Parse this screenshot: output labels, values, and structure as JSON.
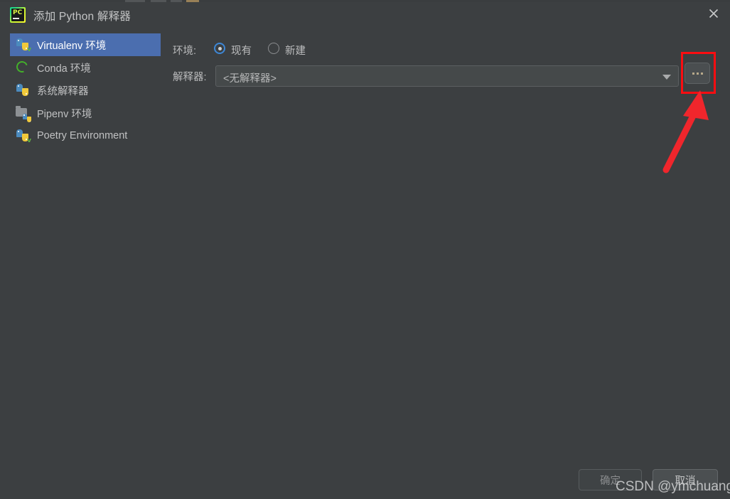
{
  "window": {
    "title": "添加 Python 解释器",
    "app_icon": "pycharm-icon",
    "icon_text": "PC",
    "close_icon": "close-icon"
  },
  "sidebar": {
    "items": [
      {
        "label": "Virtualenv 环境",
        "icon": "python-virtualenv-icon",
        "selected": true
      },
      {
        "label": "Conda 环境",
        "icon": "conda-icon",
        "selected": false
      },
      {
        "label": "系统解释器",
        "icon": "python-icon",
        "selected": false
      },
      {
        "label": "Pipenv 环境",
        "icon": "pipenv-folder-icon",
        "selected": false
      },
      {
        "label": "Poetry Environment",
        "icon": "poetry-python-icon",
        "selected": false
      }
    ]
  },
  "form": {
    "environment_label": "环境:",
    "radios": [
      {
        "label": "现有",
        "selected": true
      },
      {
        "label": "新建",
        "selected": false
      }
    ],
    "interpreter_label": "解释器:",
    "interpreter_value": "<无解释器>",
    "dropdown_icon": "chevron-down-icon",
    "browse_button_label": "...",
    "browse_button_icon": "ellipsis-icon"
  },
  "footer": {
    "ok_label": "确定",
    "cancel_label": "取消"
  },
  "annotations": {
    "highlight_color": "#fb0d11",
    "arrow_color": "#f0262c",
    "target": "browse-button"
  },
  "watermark": {
    "text": "CSDN @ymchuangke"
  },
  "colors": {
    "background": "#3c3f41",
    "selection": "#4b6eaf",
    "field": "#45494a",
    "text": "#bbbbbb"
  }
}
